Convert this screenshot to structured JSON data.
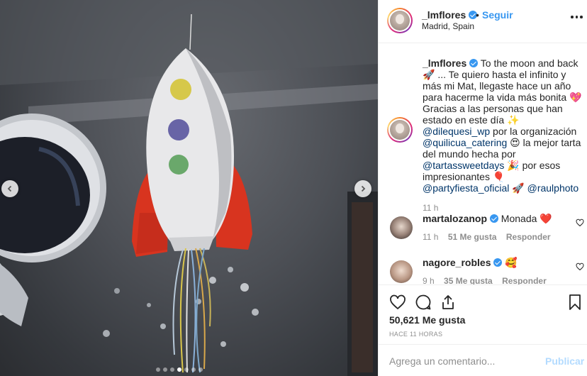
{
  "post": {
    "username": "_lmflores",
    "follow_label": "Seguir",
    "separator": "•",
    "location": "Madrid, Spain"
  },
  "caption": {
    "username": "_lmflores",
    "part1": "To the moon and back 🚀 ... Te quiero hasta el infinito y más mi Mat, llegaste hace un año para hacerme la vida más bonita 💖 Gracias a las personas que han estado en este día ✨",
    "mention1": "@dilequesi_wp",
    "part2": "por la organización",
    "mention2": "@quilicua_catering",
    "part3": "😍 la mejor tarta del mundo hecha por",
    "mention3": "@tartassweetdays",
    "part4": "🎉 por esos impresionantes 🎈",
    "mention4": "@partyfiesta_oficial",
    "part5": "🚀",
    "mention5": "@raulphoto",
    "time": "11 h"
  },
  "comments": [
    {
      "username": "martalozanop",
      "text": "Monada ❤️",
      "time": "11 h",
      "likes": "51 Me gusta",
      "reply": "Responder"
    },
    {
      "username": "nagore_robles",
      "text": "🥰",
      "time": "9 h",
      "likes": "35 Me gusta",
      "reply": "Responder"
    }
  ],
  "actions": {
    "likes": "50,621 Me gusta",
    "time_ago": "HACE 11 HORAS"
  },
  "composer": {
    "placeholder": "Agrega un comentario...",
    "publish_label": "Publicar"
  },
  "carousel": {
    "total": 7,
    "active_index": 3
  },
  "colors": {
    "accent": "#3897f0",
    "publish_disabled": "#b3dbff",
    "heart_red": "#ed4956"
  },
  "icons": [
    "chevron-left-icon",
    "chevron-right-icon",
    "heart-icon",
    "comment-icon",
    "share-icon",
    "bookmark-icon",
    "more-icon",
    "verified-icon"
  ]
}
